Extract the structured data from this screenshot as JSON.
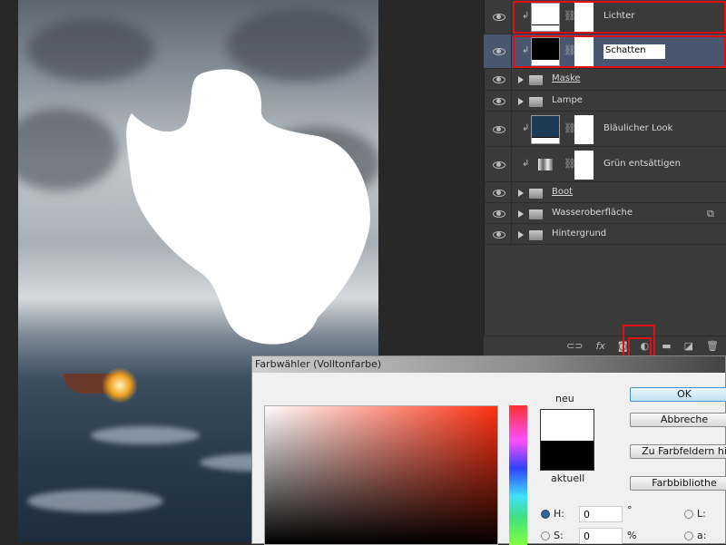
{
  "layers": [
    {
      "name": "Lichter",
      "type": "adjustment",
      "thumb": "#ffffff"
    },
    {
      "name": "Schatten",
      "type": "adjustment",
      "thumb": "#000000",
      "editing": true
    },
    {
      "name": "Maske",
      "type": "group"
    },
    {
      "name": "Lampe",
      "type": "group"
    },
    {
      "name": "Bläulicher Look",
      "type": "adjustment",
      "thumb": "#1d3a55"
    },
    {
      "name": "Grün entsättigen",
      "type": "adjustment"
    },
    {
      "name": "Boot",
      "type": "group"
    },
    {
      "name": "Wasseroberfläche",
      "type": "group"
    },
    {
      "name": "Hintergrund",
      "type": "group"
    }
  ],
  "toolbar": {
    "fx": "fx"
  },
  "dialog": {
    "title": "Farbwähler (Volltonfarbe)",
    "new_label": "neu",
    "current_label": "aktuell",
    "ok": "OK",
    "cancel": "Abbreche",
    "swatches": "Zu Farbfeldern hi",
    "libraries": "Farbbibliothe",
    "h_label": "H:",
    "h_value": "0",
    "h_unit": "°",
    "s_label": "S:",
    "s_value": "0",
    "s_unit": "%",
    "l_label": "L:",
    "a_label": "a:"
  },
  "colors": {
    "highlight": "#e01010",
    "new_color": "#ffffff",
    "current_color": "#000000"
  }
}
